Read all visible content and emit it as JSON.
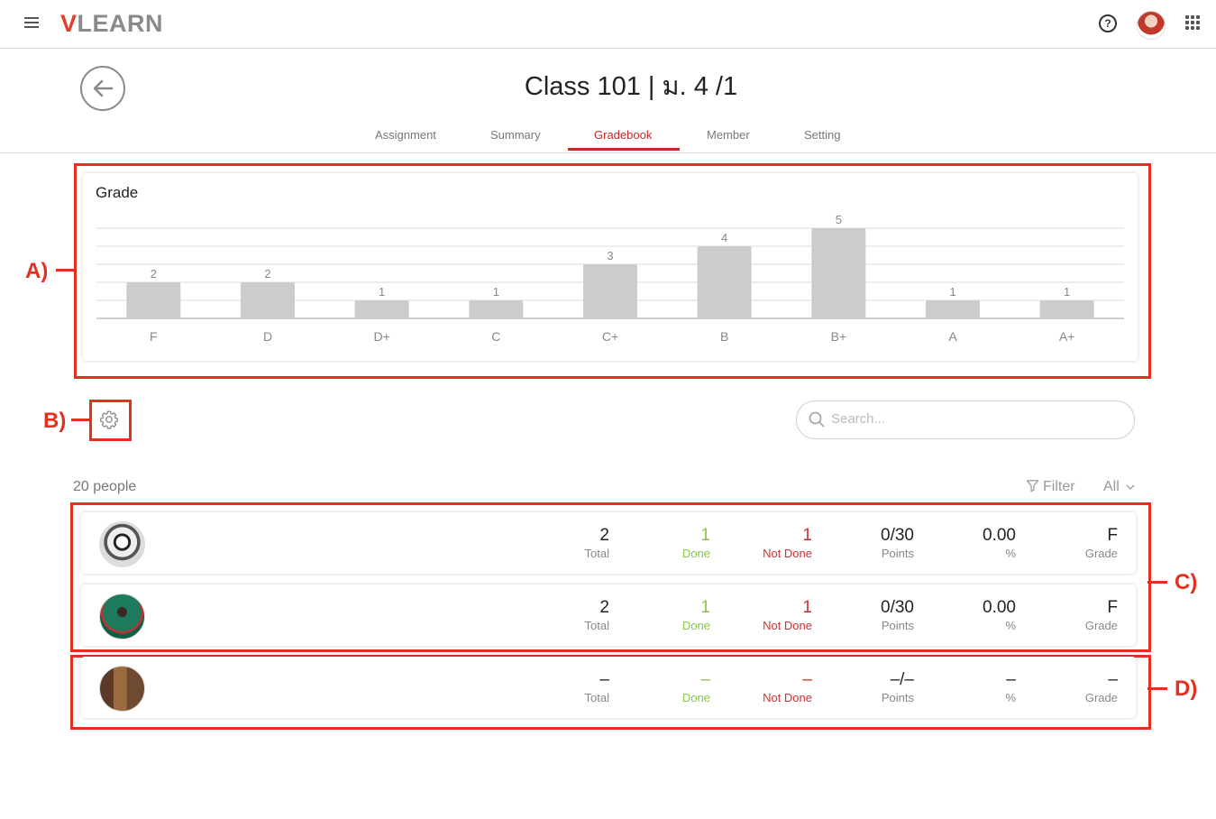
{
  "app": {
    "logo_v": "V",
    "logo_rest": "LEARN"
  },
  "header": {
    "title": "Class 101 | ม. 4 /1"
  },
  "tabs": [
    {
      "label": "Assignment"
    },
    {
      "label": "Summary"
    },
    {
      "label": "Gradebook",
      "active": true
    },
    {
      "label": "Member"
    },
    {
      "label": "Setting"
    }
  ],
  "annotations": {
    "a": "A)",
    "b": "B)",
    "c": "C)",
    "d": "D)"
  },
  "chart_card": {
    "title": "Grade"
  },
  "chart_data": {
    "type": "bar",
    "title": "Grade",
    "categories": [
      "F",
      "D",
      "D+",
      "C",
      "C+",
      "B",
      "B+",
      "A",
      "A+"
    ],
    "values": [
      2,
      2,
      1,
      1,
      3,
      4,
      5,
      1,
      1
    ],
    "ylim": [
      0,
      5
    ],
    "grid": true,
    "bar_color": "#cccccc"
  },
  "toolbar": {
    "search_placeholder": "Search...",
    "people_count": "20 people",
    "filter_label": "Filter",
    "filter_value": "All"
  },
  "students": [
    {
      "avatar": "panda-avatar",
      "total": "2",
      "done": "1",
      "not_done": "1",
      "points": "0/30",
      "percent": "0.00",
      "grade": "F"
    },
    {
      "avatar": "girl-avatar",
      "total": "2",
      "done": "1",
      "not_done": "1",
      "points": "0/30",
      "percent": "0.00",
      "grade": "F"
    },
    {
      "avatar": "room-avatar",
      "total": "–",
      "done": "–",
      "not_done": "–",
      "points": "–/–",
      "percent": "–",
      "grade": "–"
    }
  ],
  "labels": {
    "total": "Total",
    "done": "Done",
    "not_done": "Not Done",
    "points": "Points",
    "percent": "%",
    "grade": "Grade"
  },
  "colors": {
    "accent": "#c62828",
    "done": "#8bc34a",
    "not_done": "#d32f2f",
    "annotation": "#e53020"
  }
}
